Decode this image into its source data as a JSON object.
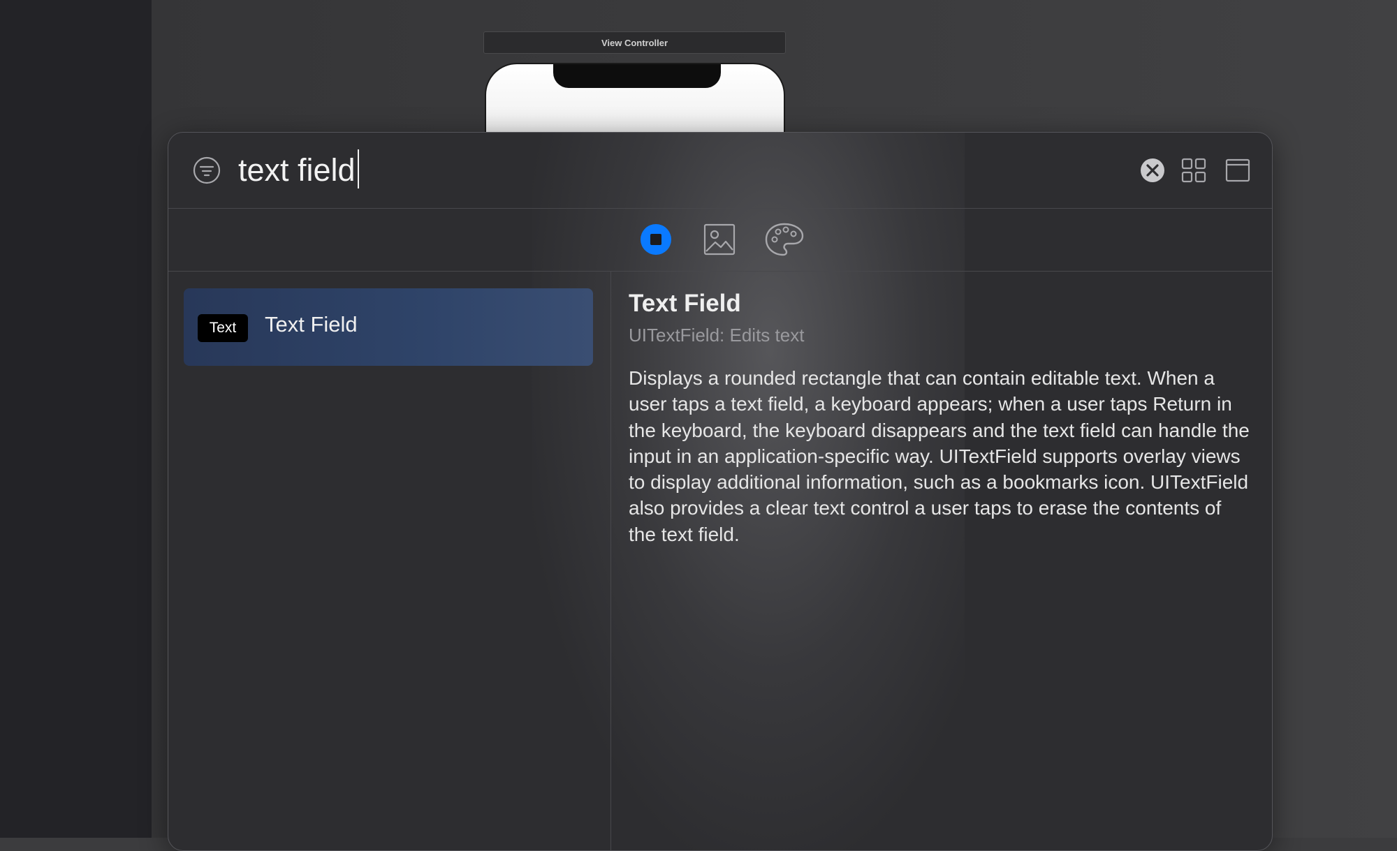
{
  "scene": {
    "title": "View Controller"
  },
  "search": {
    "value": "text field",
    "filter_icon": "filter-icon",
    "clear_icon": "clear-circle-icon",
    "grid_icon": "grid-view-icon",
    "window_icon": "window-icon"
  },
  "tabs": [
    {
      "name": "objects",
      "icon": "objects-icon",
      "selected": true
    },
    {
      "name": "media",
      "icon": "image-icon",
      "selected": false
    },
    {
      "name": "colors",
      "icon": "palette-icon",
      "selected": false
    }
  ],
  "results": [
    {
      "badge": "Text",
      "label": "Text Field",
      "selected": true
    }
  ],
  "detail": {
    "title": "Text Field",
    "subtitle": "UITextField: Edits text",
    "body": "Displays a rounded rectangle that can contain editable text. When a user taps a text field, a keyboard appears; when a user taps Return in the keyboard, the keyboard disappears and the text field can handle the input in an application-specific way. UITextField supports overlay views to display additional information, such as a bookmarks icon. UITextField also provides a clear text control a user taps to erase the contents of the text field."
  },
  "colors": {
    "accent": "#0a7aff",
    "selection": "#2f4469"
  }
}
